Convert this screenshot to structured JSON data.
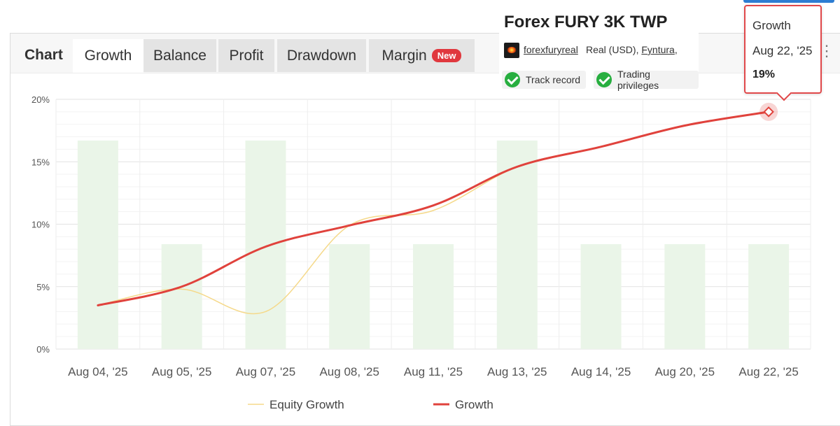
{
  "tabs": {
    "static_label": "Chart",
    "items": [
      {
        "label": "Growth",
        "active": true
      },
      {
        "label": "Balance",
        "active": false
      },
      {
        "label": "Profit",
        "active": false
      },
      {
        "label": "Drawdown",
        "active": false
      },
      {
        "label": "Margin",
        "active": false,
        "badge": "New"
      }
    ]
  },
  "system": {
    "title": "Forex FURY 3K TWP",
    "username": "forexfuryreal",
    "account_type": "Real (USD),",
    "broker": "Fyntura",
    "broker_suffix": ",",
    "badges": [
      "Track record",
      "Trading privileges"
    ]
  },
  "tooltip": {
    "series": "Growth",
    "date": "Aug 22, '25",
    "value": "19%"
  },
  "colors": {
    "growth": "#e0423c",
    "equity": "#f5d98a",
    "bars": "#eaf5e8",
    "badge": "#e0383e",
    "check": "#27ae3f"
  },
  "icons": {
    "avatar": "flame-logo",
    "check": "check-circle-icon",
    "menu": "vertical-dots-icon"
  },
  "chart_data": {
    "type": "line",
    "categories": [
      "Aug 04, '25",
      "Aug 05, '25",
      "Aug 07, '25",
      "Aug 08, '25",
      "Aug 11, '25",
      "Aug 13, '25",
      "Aug 14, '25",
      "Aug 20, '25",
      "Aug 22, '25"
    ],
    "ylim": [
      0,
      20
    ],
    "yticks": [
      "0%",
      "5%",
      "10%",
      "15%",
      "20%"
    ],
    "grid": true,
    "legend_position": "bottom",
    "series": [
      {
        "name": "Equity Growth",
        "values": [
          3.5,
          4.8,
          3.0,
          9.9,
          11.1,
          14.6,
          16.2,
          17.9,
          19.0
        ]
      },
      {
        "name": "Growth",
        "values": [
          3.5,
          5.0,
          8.2,
          9.9,
          11.5,
          14.6,
          16.2,
          17.9,
          19.0
        ]
      }
    ],
    "background_bars": [
      16.7,
      8.4,
      16.7,
      8.4,
      8.4,
      16.7,
      8.4,
      8.4,
      8.4
    ]
  }
}
